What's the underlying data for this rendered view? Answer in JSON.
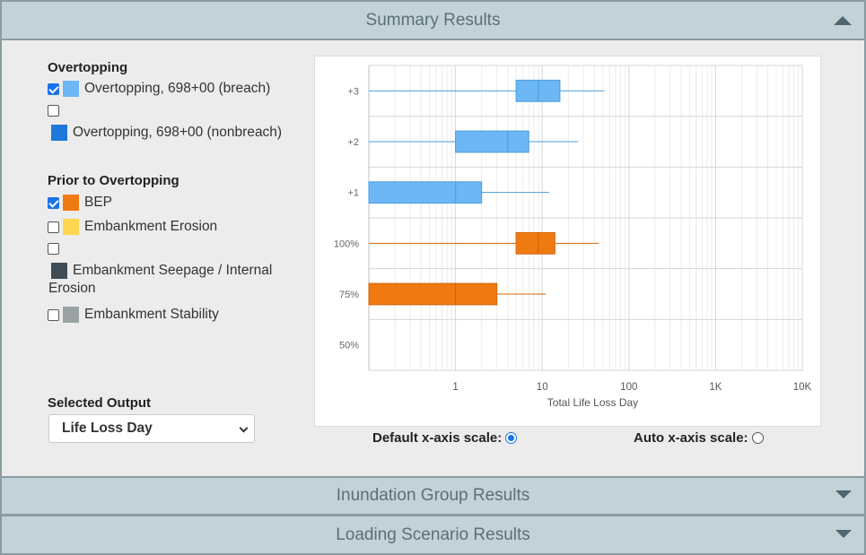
{
  "sections": {
    "summary": {
      "title": "Summary Results",
      "expanded": true
    },
    "inundation": {
      "title": "Inundation Group Results",
      "expanded": false
    },
    "loading": {
      "title": "Loading Scenario Results",
      "expanded": false
    }
  },
  "groups": {
    "overtopping": {
      "title": "Overtopping",
      "items": [
        {
          "label": "Overtopping, 698+00 (breach)",
          "checked": true,
          "color": "#6db7f5"
        },
        {
          "label": "Overtopping, 698+00 (nonbreach)",
          "checked": false,
          "color": "#1e78d8"
        }
      ]
    },
    "prior": {
      "title": "Prior to Overtopping",
      "items": [
        {
          "label": "BEP",
          "checked": true,
          "color": "#f07a12"
        },
        {
          "label": "Embankment Erosion",
          "checked": false,
          "color": "#ffd54f"
        },
        {
          "label": "Embankment Seepage / Internal",
          "label_line2": "Erosion",
          "checked": false,
          "color": "#3f4b55"
        },
        {
          "label": "Embankment Stability",
          "checked": false,
          "color": "#9aa3a3"
        }
      ]
    }
  },
  "output": {
    "title": "Selected Output",
    "selected": "Life Loss Day"
  },
  "scale": {
    "default_label": "Default x-axis scale:",
    "auto_label": "Auto x-axis scale:",
    "selected": "default"
  },
  "chart_data": {
    "type": "boxplot",
    "orientation": "horizontal",
    "xlabel": "Total Life Loss Day",
    "xscale": "log",
    "xlim": [
      0.1,
      10000
    ],
    "xticks": [
      1,
      10,
      100,
      1000,
      10000
    ],
    "xtick_labels": [
      "1",
      "10",
      "100",
      "1K",
      "10K"
    ],
    "categories": [
      "+3",
      "+2",
      "+1",
      "100%",
      "75%",
      "50%"
    ],
    "grid": true,
    "boxes": [
      {
        "category": "+3",
        "color": "#6db7f5",
        "whisker_low": 0.1,
        "q1": 5,
        "median": 9,
        "q3": 16,
        "whisker_high": 52
      },
      {
        "category": "+2",
        "color": "#6db7f5",
        "whisker_low": 0.1,
        "q1": 1,
        "median": 4,
        "q3": 7,
        "whisker_high": 26
      },
      {
        "category": "+1",
        "color": "#6db7f5",
        "whisker_low": 0.1,
        "q1": 0.1,
        "median": 1,
        "q3": 2,
        "whisker_high": 12
      },
      {
        "category": "100%",
        "color": "#f07a12",
        "whisker_low": 0.1,
        "q1": 5,
        "median": 9,
        "q3": 14,
        "whisker_high": 45
      },
      {
        "category": "75%",
        "color": "#f07a12",
        "whisker_low": 0.1,
        "q1": 0.1,
        "median": 1,
        "q3": 3,
        "whisker_high": 11
      }
    ]
  }
}
